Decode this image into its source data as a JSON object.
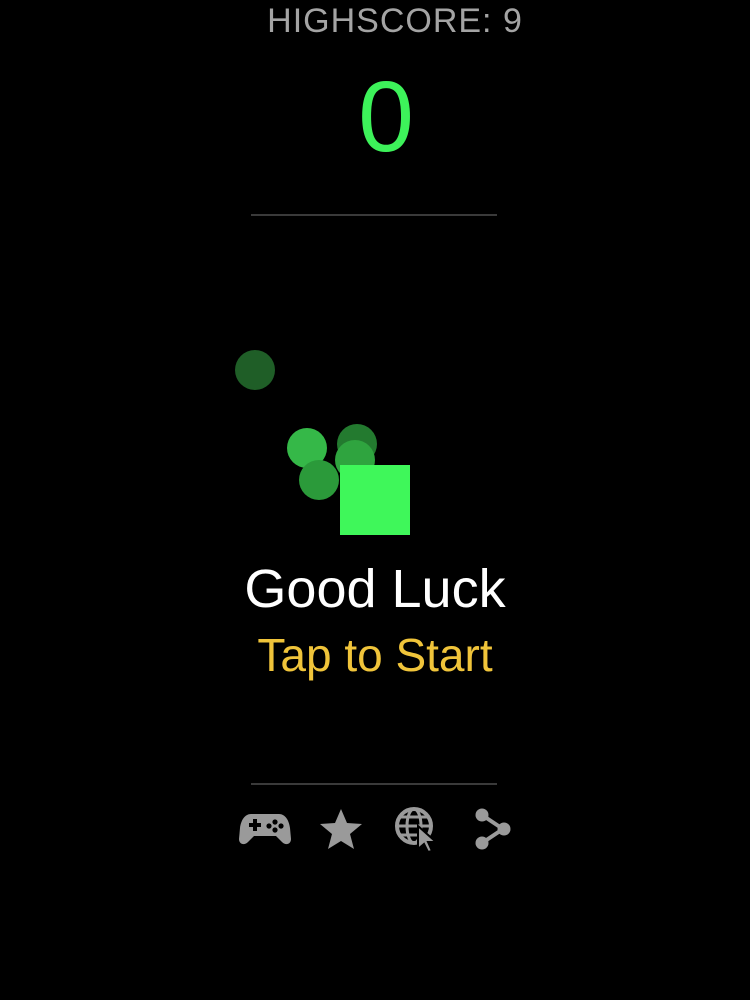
{
  "header": {
    "highscore_text": "HIGHSCORE: 9",
    "score": "0"
  },
  "overlay": {
    "title": "Good Luck",
    "subtitle": "Tap to Start"
  },
  "toolbar": {
    "icons": [
      "gamepad-icon",
      "star-icon",
      "globe-cursor-icon",
      "share-icon"
    ]
  },
  "colors": {
    "background": "#000000",
    "score": "#3df25a",
    "highscore": "#a4a4a4",
    "player": "#3ff75a",
    "subtitle": "#f0c43a",
    "icon": "#9a9a9a",
    "divider": "#3a3a3a"
  }
}
